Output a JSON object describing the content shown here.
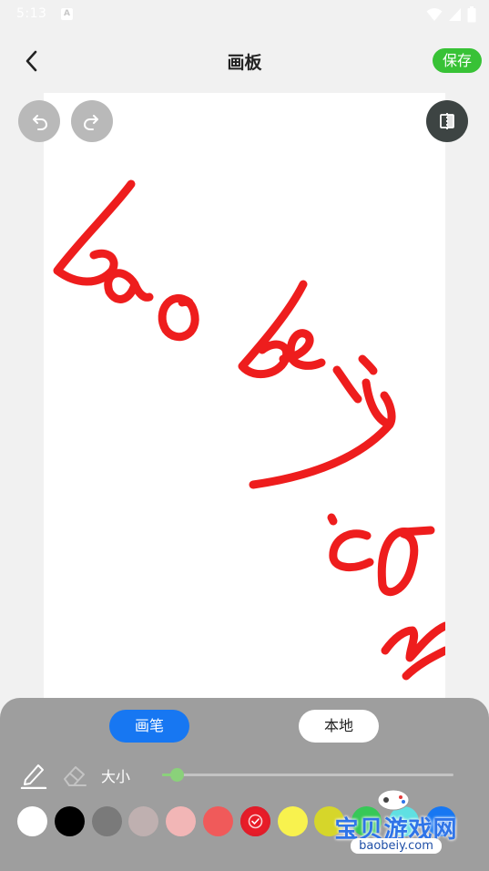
{
  "status_bar": {
    "time": "5:13",
    "notification_letter": "A"
  },
  "header": {
    "title": "画板",
    "save_label": "保存"
  },
  "panel": {
    "tabs": [
      {
        "label": "画笔",
        "active": true
      },
      {
        "label": "本地",
        "active": false
      }
    ],
    "size_label": "大小",
    "size_value_fraction": 0.05,
    "selected_tool": "pen",
    "colors": [
      "#ffffff",
      "#000000",
      "#7a7a7a",
      "#bfb0b0",
      "#f2b6b6",
      "#f05a5a",
      "#e81c28",
      "#f8f24e",
      "#d6d62a",
      "#37c857",
      "#5fe0e2",
      "#1777f2"
    ],
    "selected_color": "#e81c28"
  },
  "watermark": {
    "text": "宝贝游戏网",
    "url": "baobeiy.com"
  },
  "drawing": {
    "stroke_color": "#ee1d1d"
  }
}
